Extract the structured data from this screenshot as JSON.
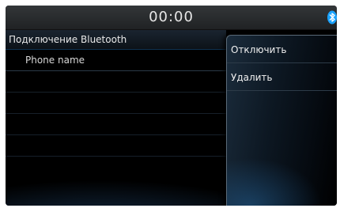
{
  "status_bar": {
    "clock": "00:00",
    "bluetooth_icon": "bluetooth-icon",
    "bluetooth_color": "#1aa3ff"
  },
  "bluetooth_screen": {
    "title": "Подключение Bluetooth",
    "devices": [
      {
        "name": "Phone name"
      }
    ]
  },
  "context_menu": {
    "items": [
      {
        "label": "Отключить"
      },
      {
        "label": "Удалить"
      }
    ]
  }
}
